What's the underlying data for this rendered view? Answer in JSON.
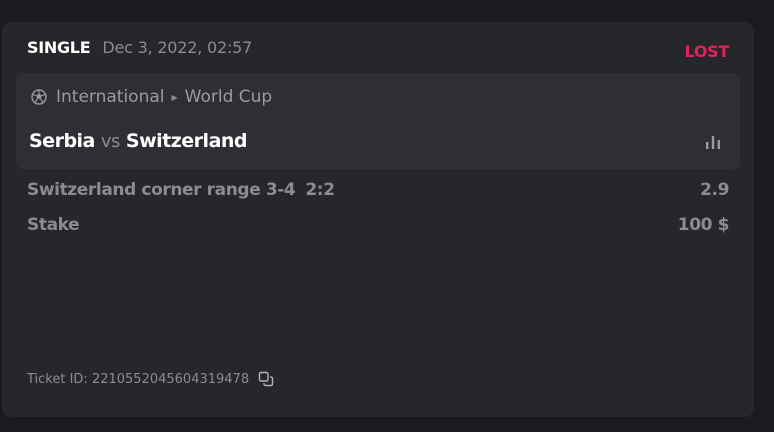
{
  "ticket": {
    "bet_type": "SINGLE",
    "date": "Dec 3, 2022, 02:57",
    "status": "LOST",
    "status_color": "#e5215d",
    "event": {
      "sport_icon": "soccer-ball-icon",
      "category": "International",
      "tournament": "World Cup",
      "home_team": "Serbia",
      "vs": "vs",
      "away_team": "Switzerland",
      "stats_icon": "bar-chart-icon"
    },
    "selection": {
      "market": "Switzerland corner range 3-4",
      "score": "2:2",
      "odds": "2.9"
    },
    "stake": {
      "label": "Stake",
      "value": "100 $"
    },
    "ticket_id_label": "Ticket ID: 2210552045604319478",
    "copy_icon": "copy-icon"
  }
}
